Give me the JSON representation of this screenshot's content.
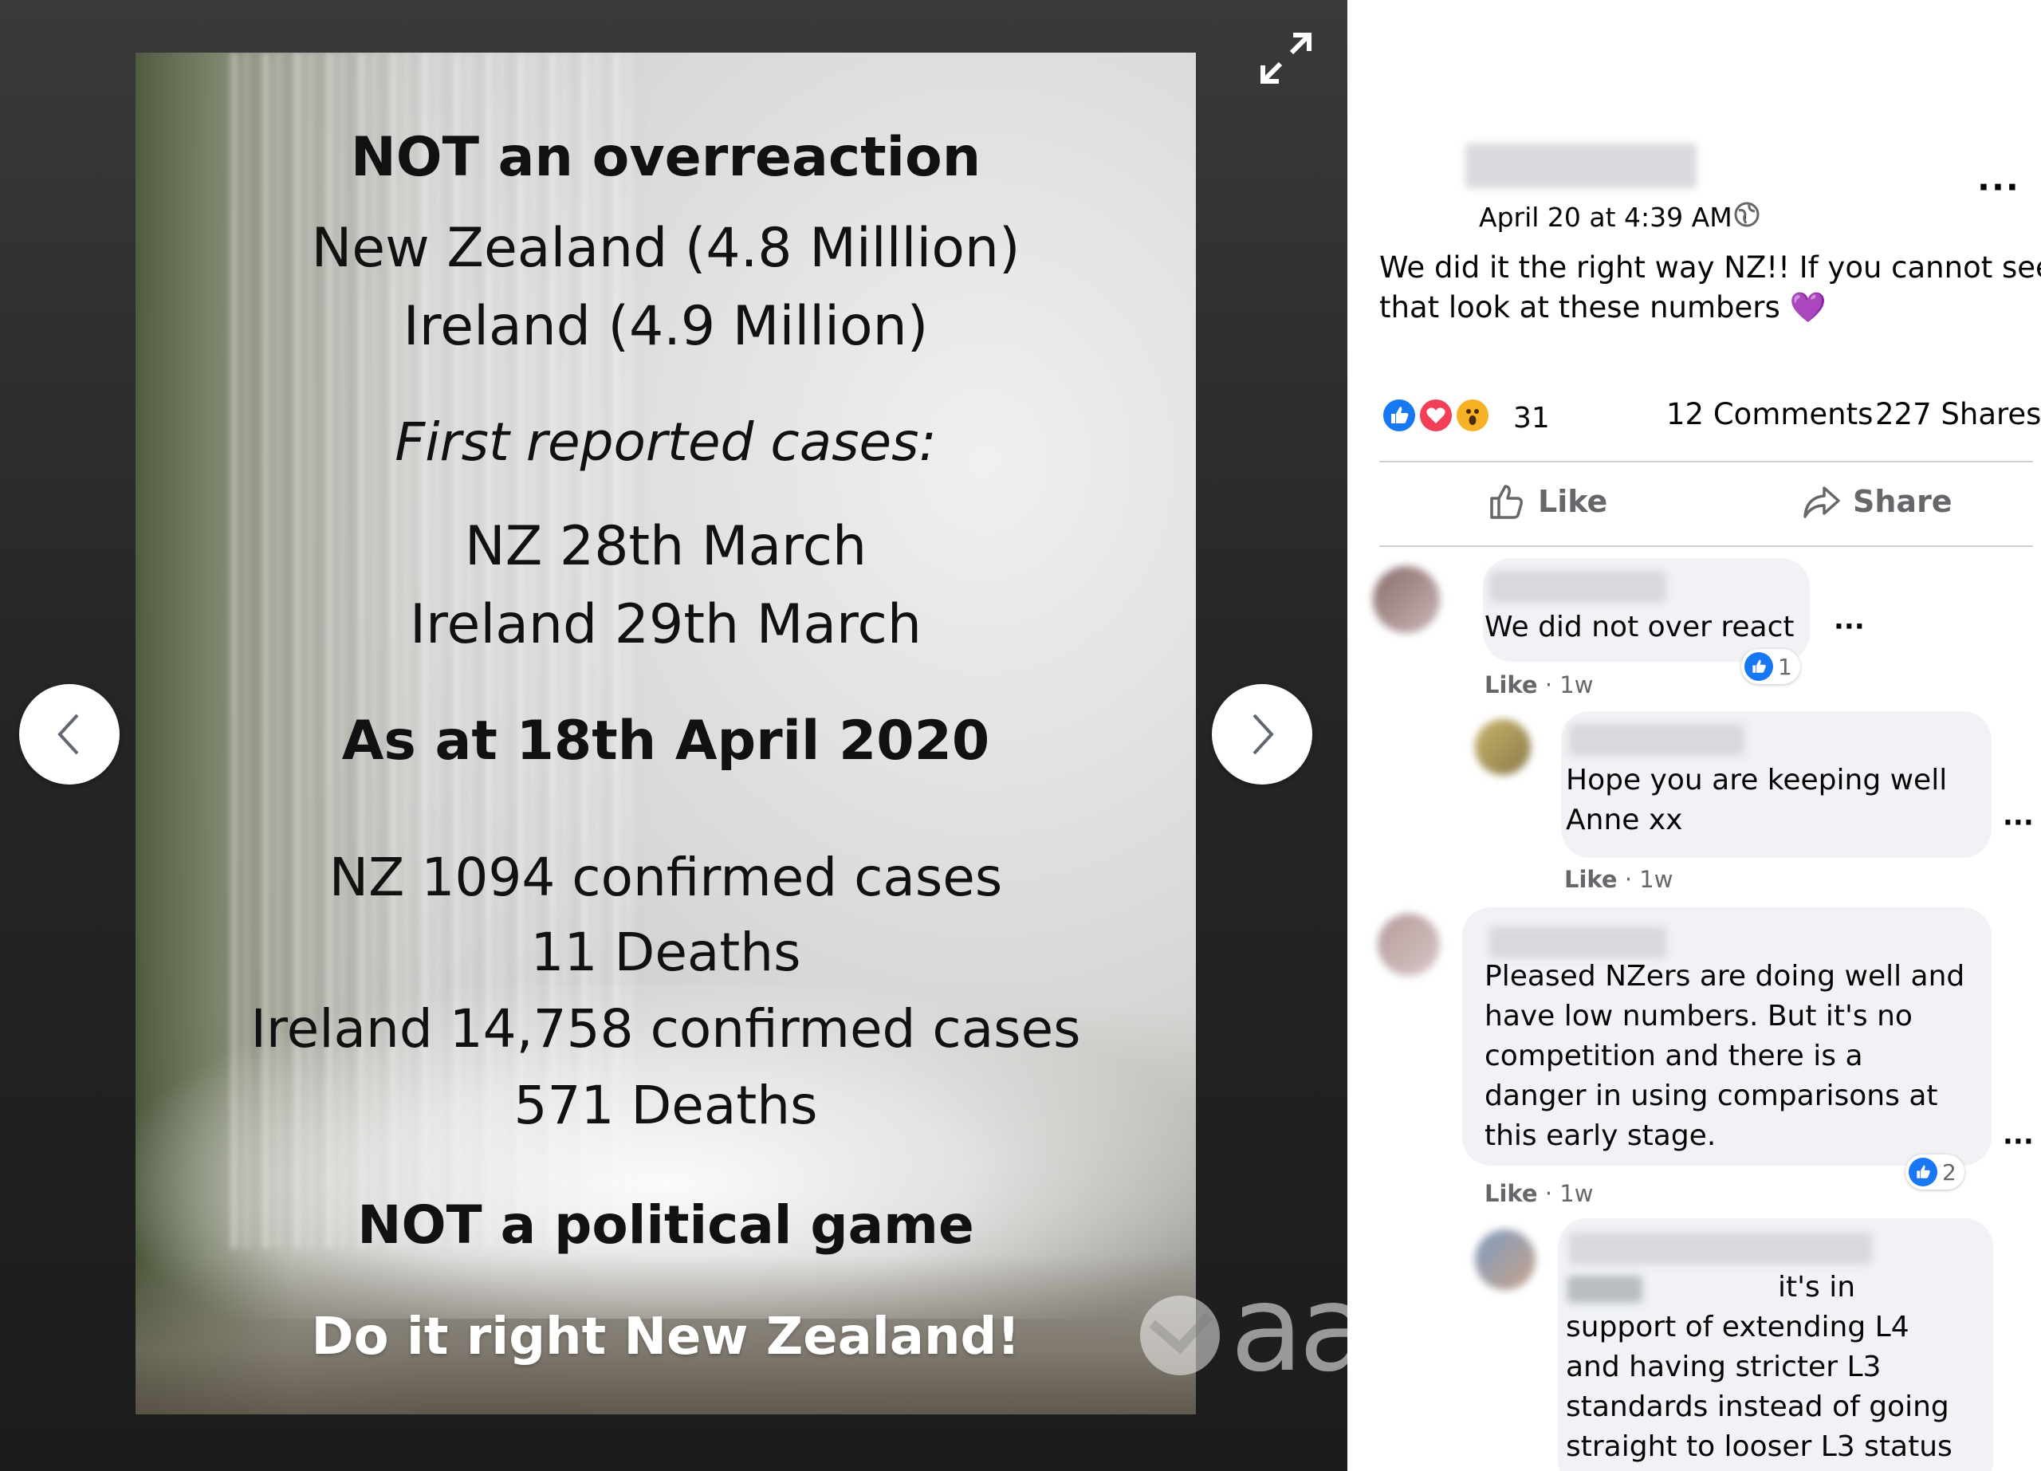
{
  "image": {
    "lines": {
      "l1": "NOT an overreaction",
      "l2": "New Zealand (4.8 Milllion)",
      "l3": "Ireland (4.9 Million)",
      "l4": "First reported cases:",
      "l5": "NZ 28th March",
      "l6": "Ireland 29th March",
      "l7": "As at 18th April 2020",
      "l8": "NZ 1094 confirmed cases",
      "l9": "11 Deaths",
      "l10": "Ireland 14,758 confirmed cases",
      "l11": "571 Deaths",
      "l12": "NOT a political game",
      "l13": "Do it right New Zealand!"
    },
    "watermark": "aa"
  },
  "post": {
    "timestamp": "April 20 at 4:39 AM ·",
    "text_line1": "We did it the right way NZ!! If you cannot see",
    "text_line2": "that look at these numbers",
    "emoji": "💜",
    "reaction_count": "31",
    "comments_count": "12 Comments",
    "shares_count": "227 Shares",
    "like_label": "Like",
    "share_label": "Share",
    "more_label": "···"
  },
  "comments": [
    {
      "text": "We did not over react",
      "like_label": "Like",
      "age": "· 1w",
      "reactions": "1"
    },
    {
      "line1": "Hope you are keeping well",
      "line2": "Anne xx",
      "like_label": "Like",
      "age": "· 1w"
    },
    {
      "line1": "Pleased NZers are doing well and",
      "line2": "have low numbers. But it's no",
      "line3": "competition and there is a",
      "line4": "danger in using comparisons at",
      "line5": "this early stage.",
      "like_label": "Like",
      "age": "· 1w",
      "reactions": "2"
    },
    {
      "line1": "it's in",
      "line2": "support of extending L4",
      "line3": "and having stricter L3",
      "line4": "standards instead of going",
      "line5": "straight to looser L3 status"
    }
  ],
  "colors": {
    "accent": "#1877f2",
    "love": "#f33e58",
    "wow": "#f7b125",
    "viewer_bg": "#262626"
  }
}
